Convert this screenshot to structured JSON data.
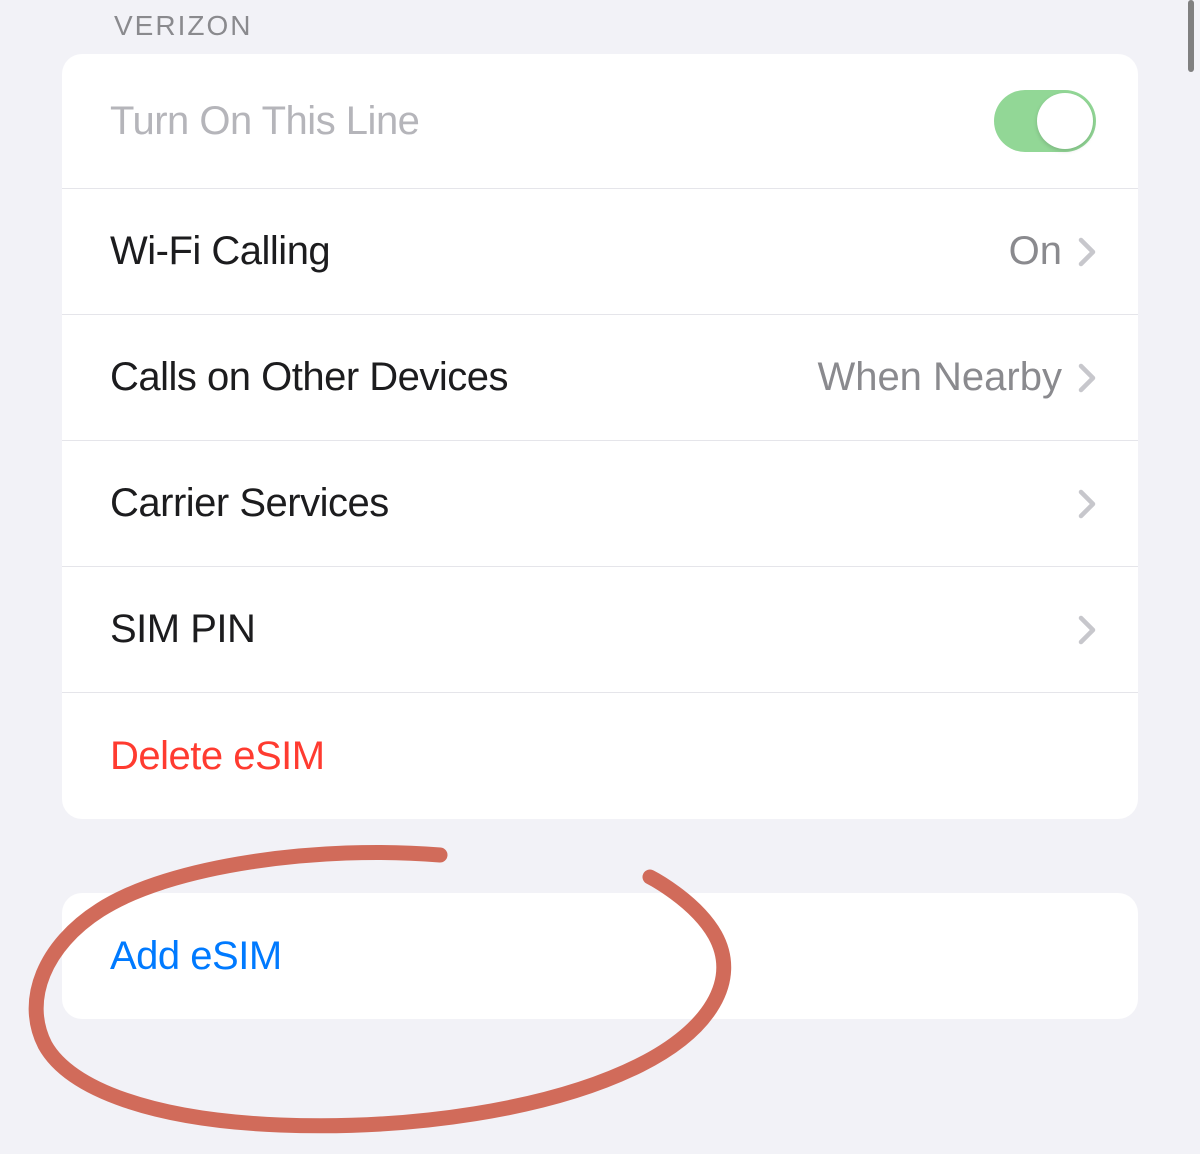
{
  "section": {
    "header": "VERIZON",
    "rows": {
      "turn_on_line": {
        "label": "Turn On This Line",
        "toggle_on": true
      },
      "wifi_calling": {
        "label": "Wi-Fi Calling",
        "value": "On"
      },
      "calls_other_devices": {
        "label": "Calls on Other Devices",
        "value": "When Nearby"
      },
      "carrier_services": {
        "label": "Carrier Services"
      },
      "sim_pin": {
        "label": "SIM PIN"
      },
      "delete_esim": {
        "label": "Delete eSIM"
      }
    }
  },
  "add_group": {
    "add_esim": {
      "label": "Add eSIM"
    }
  }
}
